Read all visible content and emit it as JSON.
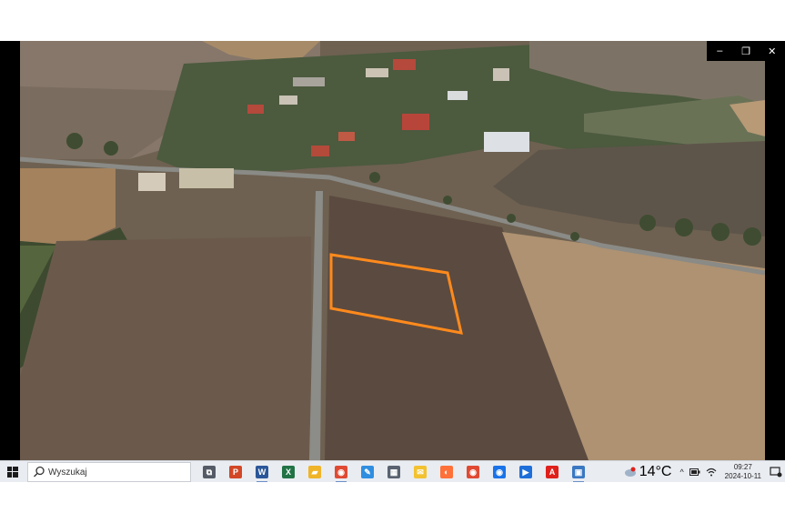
{
  "window_controls": {
    "minimize_glyph": "–",
    "restore_glyph": "❐",
    "close_glyph": "✕"
  },
  "video": {
    "highlight_color": "#ff8a1c"
  },
  "taskbar": {
    "search": {
      "placeholder": "Wyszukaj"
    },
    "apps": [
      {
        "name": "task-view-icon",
        "color": "#555b66",
        "glyph": "⧉"
      },
      {
        "name": "powerpoint-icon",
        "color": "#d24726",
        "glyph": "P"
      },
      {
        "name": "word-icon",
        "color": "#2b579a",
        "glyph": "W"
      },
      {
        "name": "excel-icon",
        "color": "#217346",
        "glyph": "X"
      },
      {
        "name": "file-explorer-icon",
        "color": "#f0b429",
        "glyph": "▰"
      },
      {
        "name": "chrome-icon",
        "color": "#e04a33",
        "glyph": "◉"
      },
      {
        "name": "paint-icon",
        "color": "#2f8ee0",
        "glyph": "✎"
      },
      {
        "name": "calculator-icon",
        "color": "#5a6270",
        "glyph": "▦"
      },
      {
        "name": "sticky-notes-icon",
        "color": "#f2c230",
        "glyph": "✉"
      },
      {
        "name": "firefox-icon",
        "color": "#ff7139",
        "glyph": "◐"
      },
      {
        "name": "chrome-alt-icon",
        "color": "#e04a33",
        "glyph": "◉"
      },
      {
        "name": "chrome-canary-icon",
        "color": "#1a73e8",
        "glyph": "◉"
      },
      {
        "name": "media-player-icon",
        "color": "#1e6fd9",
        "glyph": "▶"
      },
      {
        "name": "acrobat-icon",
        "color": "#e0201b",
        "glyph": "A"
      },
      {
        "name": "photos-icon",
        "color": "#3a78c2",
        "glyph": "▣"
      }
    ],
    "weather": {
      "temperature": "14°C"
    },
    "tray": {
      "chevron": "^"
    },
    "clock": {
      "time": "09:27",
      "date": "2024-10-11"
    }
  }
}
